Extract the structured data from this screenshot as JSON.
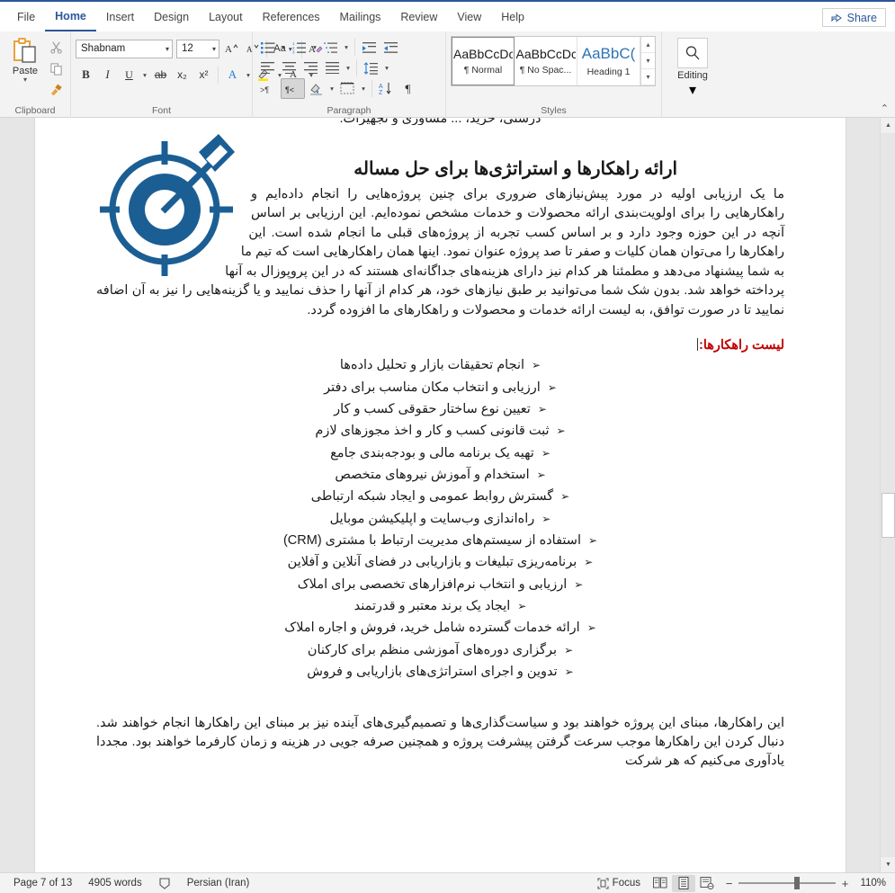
{
  "window": {
    "accent_color": "#2b579a",
    "share_label": "Share"
  },
  "ribbon_tabs": [
    {
      "label": "File",
      "active": false
    },
    {
      "label": "Home",
      "active": true
    },
    {
      "label": "Insert",
      "active": false
    },
    {
      "label": "Design",
      "active": false
    },
    {
      "label": "Layout",
      "active": false
    },
    {
      "label": "References",
      "active": false
    },
    {
      "label": "Mailings",
      "active": false
    },
    {
      "label": "Review",
      "active": false
    },
    {
      "label": "View",
      "active": false
    },
    {
      "label": "Help",
      "active": false
    }
  ],
  "groups": {
    "clipboard": {
      "label": "Clipboard",
      "paste_label": "Paste",
      "cut_icon": "scissors-icon",
      "copy_icon": "copy-icon",
      "format_painter_icon": "format-painter-icon"
    },
    "font": {
      "label": "Font",
      "font_name": "Shabnam",
      "font_size": "12",
      "grow_font": "A^",
      "shrink_font": "Av",
      "change_case": "Aa",
      "clear_formatting": "clear-formatting-icon",
      "bold": "B",
      "italic": "I",
      "underline": "U",
      "strikethrough": "ab",
      "subscript": "x₂",
      "superscript": "x²",
      "text_effects": "A",
      "highlight": "highlight-icon",
      "font_color": "A"
    },
    "paragraph": {
      "label": "Paragraph",
      "bullets": "bullets-icon",
      "numbering": "numbering-icon",
      "multilevel": "multilevel-list-icon",
      "decrease_indent": "decrease-indent-icon",
      "increase_indent": "increase-indent-icon",
      "align_left": "align-left-icon",
      "align_center": "align-center-icon",
      "align_right": "align-right-icon",
      "justify": "justify-icon",
      "line_spacing": "line-spacing-icon",
      "ltr_text": "ltr-icon",
      "rtl_text": "rtl-icon",
      "rtl_active": true,
      "shading": "shading-icon",
      "borders": "borders-icon",
      "sort": "sort-icon",
      "show_marks": "pilcrow-icon"
    },
    "styles": {
      "label": "Styles",
      "items": [
        {
          "sample": "AaBbCcDc",
          "name": "¶ Normal",
          "selected": true
        },
        {
          "sample": "AaBbCcDc",
          "name": "¶ No Spac...",
          "selected": false
        },
        {
          "sample": "AaBbC(",
          "name": "Heading 1",
          "selected": false
        }
      ]
    },
    "editing": {
      "label": "Editing",
      "button_label": "Editing",
      "icon": "search-icon"
    }
  },
  "document": {
    "cut_top_line": "درستی، خرید، ... مشاوری و تجهیزات.",
    "heading": "ارائه راهکارها و استراتژی‌ها برای حل مساله",
    "icon_alt": "target-dart-icon",
    "paragraph1": "ما یک ارزیابی اولیه در مورد پیش‌نیازهای ضروری برای چنین پروژه‌هایی را انجام داده‌ایم و راهکارهایی را برای اولویت‌بندی ارائه محصولات و خدمات مشخص نموده‌ایم. این ارزیابی بر اساس آنچه در این حوزه وجود دارد و بر اساس کسب تجربه از پروژه‌های قبلی ما انجام شده است. این راهکارها را می‌توان همان کلیات و صفر تا صد پروژه عنوان نمود. اینها همان راهکارهایی است که تیم ما به شما پیشنهاد می‌دهد و مطمئنا هر کدام نیز دارای هزینه‌های جداگانه‌ای هستند که در این پروپوزال به آنها پرداخته خواهد شد. بدون شک شما می‌توانید بر طبق نیازهای خود، هر کدام از آنها را حذف نمایید و یا گزینه‌هایی را نیز به آن اضافه نمایید تا در صورت توافق، به لیست ارائه خدمات و محصولات و راهکارهای ما افزوده گردد.",
    "list_heading": "لیست راهکارها:",
    "list_heading_color": "#c00000",
    "list_items": [
      "انجام تحقیقات بازار و تحلیل داده‌ها",
      "ارزیابی و انتخاب مکان مناسب برای دفتر",
      "تعیین نوع ساختار حقوقی کسب و کار",
      "ثبت قانونی کسب و کار و اخذ مجوزهای لازم",
      "تهیه یک برنامه مالی و بودجه‌بندی جامع",
      "استخدام و آموزش نیروهای متخصص",
      "گسترش روابط عمومی و ایجاد شبکه ارتباطی",
      "راه‌اندازی وب‌سایت و اپلیکیشن موبایل",
      "استفاده از سیستم‌های مدیریت ارتباط با مشتری (CRM)",
      "برنامه‌ریزی تبلیغات و بازاریابی در فضای آنلاین و آفلاین",
      "ارزیابی و انتخاب نرم‌افزارهای تخصصی برای املاک",
      "ایجاد یک برند معتبر و قدرتمند",
      "ارائه خدمات گسترده شامل خرید، فروش و اجاره املاک",
      "برگزاری دوره‌های آموزشی منظم برای کارکنان",
      "تدوین و اجرای استراتژی‌های بازاریابی و فروش"
    ],
    "bullet_glyph": "➢",
    "paragraph2": "این راهکارها، مبنای این پروژه خواهند بود و سیاست‌گذاری‌ها و تصمیم‌گیری‌های آینده نیز بر مبنای این راهکارها انجام خواهند شد. دنبال کردن این راهکارها موجب سرعت گرفتن پیشرفت پروژه و همچنین صرفه جویی در هزینه و زمان کارفرما خواهند بود. مجددا یادآوری می‌کنیم که هر شرکت"
  },
  "statusbar": {
    "page": "Page 7 of 13",
    "words": "4905 words",
    "proofing_icon": "proofing-icon",
    "language": "Persian (Iran)",
    "focus_label": "Focus",
    "focus_icon": "focus-icon",
    "read_mode_icon": "read-mode-icon",
    "print_layout_icon": "print-layout-icon",
    "web_layout_icon": "web-layout-icon",
    "active_view": "print-layout",
    "zoom_out": "−",
    "zoom_in": "+",
    "zoom_value": "110%"
  }
}
